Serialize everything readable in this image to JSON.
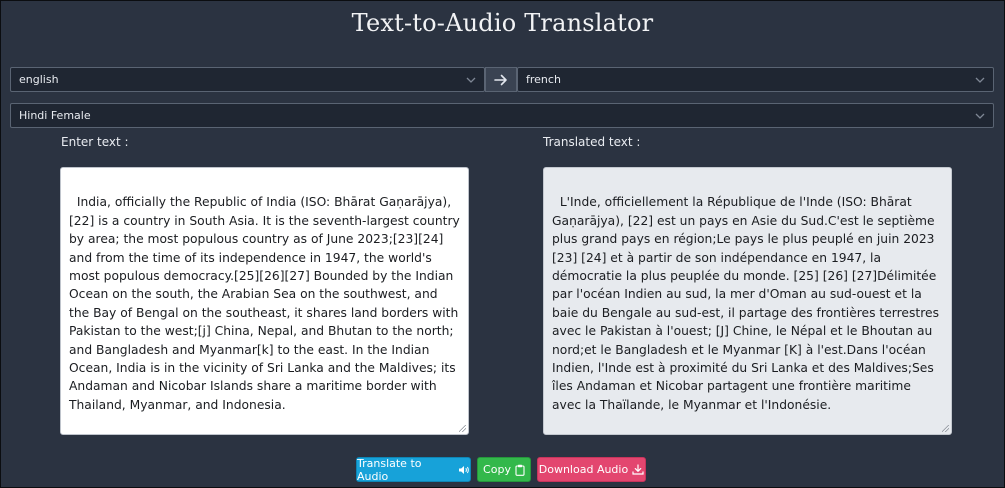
{
  "app": {
    "title": "Text-to-Audio Translator"
  },
  "languages": {
    "from": "english",
    "to": "french"
  },
  "voice": {
    "selected": "Hindi Female"
  },
  "labels": {
    "input": "Enter text :",
    "output": "Translated text :"
  },
  "input_text": "India, officially the Republic of India (ISO: Bhārat Gaṇarājya),[22] is a country in South Asia. It is the seventh-largest country by area; the most populous country as of June 2023;[23][24] and from the time of its independence in 1947, the world's most populous democracy.[25][26][27] Bounded by the Indian Ocean on the south, the Arabian Sea on the southwest, and the Bay of Bengal on the southeast, it shares land borders with Pakistan to the west;[j] China, Nepal, and Bhutan to the north; and Bangladesh and Myanmar[k] to the east. In the Indian Ocean, India is in the vicinity of Sri Lanka and the Maldives; its Andaman and Nicobar Islands share a maritime border with Thailand, Myanmar, and Indonesia.",
  "output_text": "L'Inde, officiellement la République de l'Inde (ISO: Bhārat Gaṇarājya), [22] est un pays en Asie du Sud.C'est le septième plus grand pays en région;Le pays le plus peuplé en juin 2023 [23] [24] et à partir de son indépendance en 1947, la démocratie la plus peuplée du monde. [25] [26] [27]Délimitée par l'océan Indien au sud, la mer d'Oman au sud-ouest et la baie du Bengale au sud-est, il partage des frontières terrestres avec le Pakistan à l'ouest; [J] Chine, le Népal et le Bhoutan au nord;et le Bangladesh et le Myanmar [K] à l'est.Dans l'océan Indien, l'Inde est à proximité du Sri Lanka et des Maldives;Ses îles Andaman et Nicobar partagent une frontière maritime avec la Thaïlande, le Myanmar et l'Indonésie.",
  "buttons": {
    "translate": "Translate to Audio",
    "copy": "Copy",
    "download": "Download Audio"
  },
  "icons": {
    "swap": "arrow-right-icon",
    "translate": "speaker-icon",
    "copy": "clipboard-icon",
    "download": "download-icon"
  },
  "colors": {
    "background": "#2b3341",
    "translate_button": "#17a2d9",
    "copy_button": "#33b84b",
    "download_button": "#e3466f"
  }
}
